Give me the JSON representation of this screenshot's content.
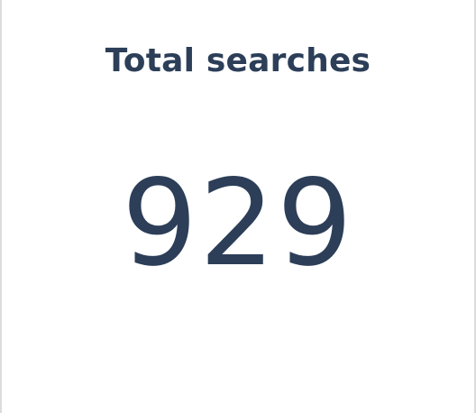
{
  "widget": {
    "title": "Total searches",
    "value": "929"
  },
  "colors": {
    "text": "#2c3e58",
    "border": "#dcdcdc",
    "background": "#ffffff"
  }
}
